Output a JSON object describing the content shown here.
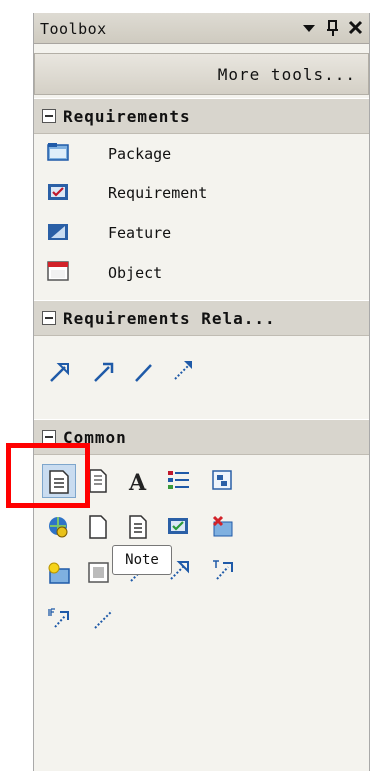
{
  "toolbox": {
    "title": "Toolbox",
    "dropdown_icon": "caret-down-icon",
    "pin_icon": "pin-icon",
    "close_icon": "close-icon",
    "more_tools": "More tools..."
  },
  "sections": {
    "requirements": {
      "header": "Requirements",
      "items": [
        {
          "label": "Package",
          "icon": "package-icon"
        },
        {
          "label": "Requirement",
          "icon": "requirement-icon"
        },
        {
          "label": "Feature",
          "icon": "feature-icon"
        },
        {
          "label": "Object",
          "icon": "object-icon"
        }
      ]
    },
    "relations": {
      "header": "Requirements Rela...",
      "icons": [
        "realize-relation-icon",
        "trace-relation-icon",
        "association-relation-icon",
        "dependency-relation-icon"
      ]
    },
    "common": {
      "header": "Common",
      "selected_icon": "note-icon",
      "tooltip": "Note"
    }
  },
  "colors": {
    "highlight": "#ff0000",
    "selection": "#c9dcf0",
    "icon_blue": "#1f5aa8"
  }
}
